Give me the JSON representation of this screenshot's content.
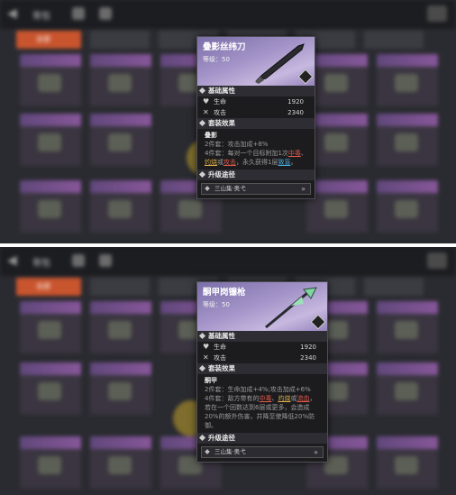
{
  "panels": [
    {
      "background": {
        "title": "背包",
        "tab_labels": [
          "全部",
          "",
          "",
          "",
          "",
          ""
        ]
      },
      "tooltip": {
        "name": "叠影丝纬刀",
        "level_label": "等级：50",
        "base_stats_title": "基础属性",
        "stats": [
          {
            "icon": "heart-icon",
            "label": "生命",
            "value": "1920"
          },
          {
            "icon": "crossed-swords-icon",
            "label": "攻击",
            "value": "2340"
          }
        ],
        "set_title": "套装效果",
        "set_name": "叠影",
        "set_line_1": "2件套：攻击加成+8%",
        "set_line_2_a": "4件套：每对一个目标附加1次",
        "set_line_2_hl1": "中毒",
        "set_line_2_b": "、",
        "set_line_2_hl2": "灼烧",
        "set_line_2_c": "或",
        "set_line_2_hl3": "攻击",
        "set_line_2_d": "，永久获得1层",
        "set_line_2_hl4": "致盲",
        "set_line_2_e": "。",
        "upgrade_title": "升级途径",
        "upgrade_path": "三山集·奥弋"
      }
    },
    {
      "background": {
        "title": "背包",
        "tab_labels": [
          "全部",
          "",
          "",
          "",
          "",
          ""
        ]
      },
      "tooltip": {
        "name": "酮甲岗镰枪",
        "level_label": "等级：50",
        "base_stats_title": "基础属性",
        "stats": [
          {
            "icon": "heart-icon",
            "label": "生命",
            "value": "1920"
          },
          {
            "icon": "crossed-swords-icon",
            "label": "攻击",
            "value": "2340"
          }
        ],
        "set_title": "套装效果",
        "set_name": "酮甲",
        "set_line_1": "2件套：生命加成+4%;攻击加成+6%",
        "set_line_2_a": "4件套：敌方带有的",
        "set_line_2_hl1": "中毒",
        "set_line_2_b": "、",
        "set_line_2_hl2": "灼烧",
        "set_line_2_c": "或",
        "set_line_2_hl3": "流血",
        "set_line_2_d": "，若在一个回数达到6层或更多，会造成20%的额外伤害，并降至使降低20%防御。",
        "upgrade_title": "升级途径",
        "upgrade_path": "三山集·奥弋"
      }
    }
  ]
}
